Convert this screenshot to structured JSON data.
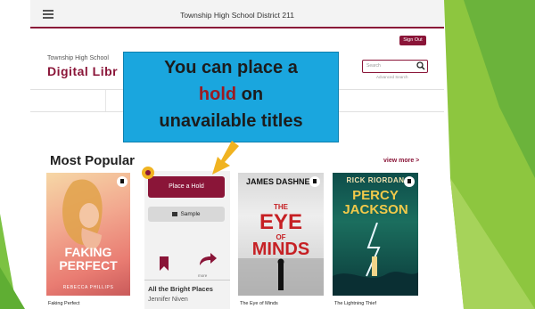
{
  "app": {
    "window_title": "Township High School District 211",
    "signout_label": "Sign Out",
    "school_name": "Township High School",
    "library_name": "Digital Libr",
    "question_mark": "?",
    "search_placeholder": "Search",
    "advanced_search_label": "Advanced Search"
  },
  "callout": {
    "line1": "You can place a",
    "line2_highlight": "hold",
    "line2_rest": " on",
    "line3": "unavailable titles"
  },
  "section": {
    "title": "Most Popular",
    "view_more": "view more >"
  },
  "books": [
    {
      "title": "Faking Perfect",
      "cover_title": "FAKING PERFECT",
      "cover_author": "REBECCA PHILLIPS"
    },
    {
      "title": "All the Bright Places",
      "author": "Jennifer Niven",
      "place_hold_label": "Place a Hold",
      "sample_label": "Sample",
      "more_label": "more"
    },
    {
      "title": "The Eye of Minds",
      "cover_author": "JAMES DASHNER",
      "cover_line1": "THE",
      "cover_line2": "EYE",
      "cover_line3": "OF",
      "cover_line4": "MINDS"
    },
    {
      "title": "The Lightning Thief",
      "cover_author": "RICK RIORDAN",
      "cover_title": "PERCY JACKSON"
    }
  ],
  "colors": {
    "brand": "#8a1538",
    "callout_bg": "#1aa6de",
    "arrow": "#f0b321",
    "slide_green": "#7cc242"
  },
  "icons": [
    "hamburger-icon",
    "search-icon",
    "bookmark-icon",
    "share-arrow-icon",
    "book-icon",
    "pointer-arrow-icon"
  ]
}
